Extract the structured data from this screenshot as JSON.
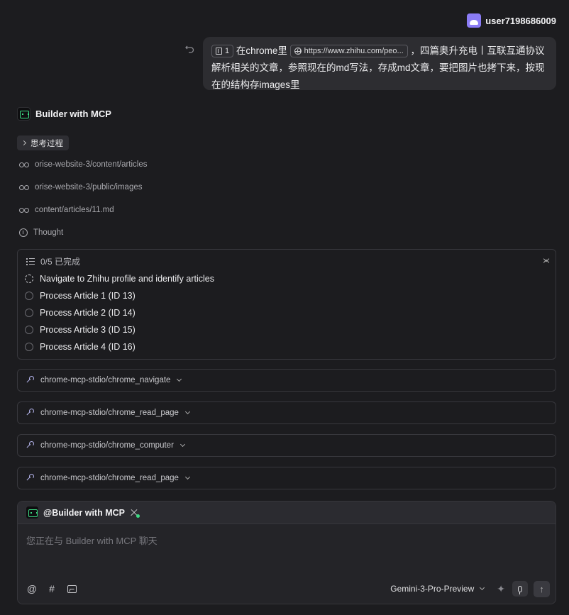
{
  "user": {
    "name": "user7198686009"
  },
  "message": {
    "chip_count": "1",
    "text_a": "在chrome里",
    "url_chip": "https://www.zhihu.com/peo...",
    "text_b": "，四篇奥升充电丨互联互通协议解析相关的文章，参照现在的md写法，存成md文章，要把图片也拷下来，按现在的结构存images里"
  },
  "agent": {
    "name": "Builder with MCP",
    "thinking_label": "思考过程",
    "reads": [
      "orise-website-3/content/articles",
      "orise-website-3/public/images",
      "content/articles/11.md"
    ],
    "thought_label": "Thought"
  },
  "todos": {
    "progress": "0/5 已完成",
    "items": [
      {
        "label": "Navigate to Zhihu profile and identify articles",
        "status": "in_progress"
      },
      {
        "label": "Process Article 1 (ID 13)",
        "status": "pending"
      },
      {
        "label": "Process Article 2 (ID 14)",
        "status": "pending"
      },
      {
        "label": "Process Article 3 (ID 15)",
        "status": "pending"
      },
      {
        "label": "Process Article 4 (ID 16)",
        "status": "pending"
      }
    ]
  },
  "tool_calls": [
    "chrome-mcp-stdio/chrome_navigate",
    "chrome-mcp-stdio/chrome_read_page",
    "chrome-mcp-stdio/chrome_computer",
    "chrome-mcp-stdio/chrome_read_page"
  ],
  "composer": {
    "mention": "@Builder with MCP",
    "placeholder": "您正在与 Builder with MCP 聊天",
    "model": "Gemini-3-Pro-Preview"
  },
  "icons": {
    "at": "@",
    "hash": "#",
    "sparkle": "✦",
    "send": "↑",
    "undo": "↶"
  },
  "colors": {
    "background": "#1c1c1f",
    "bubble": "#2d2d31",
    "accent_green": "#3ddc84",
    "avatar_purple": "#8b7cf6",
    "tool_icon": "#b7b7f0"
  }
}
